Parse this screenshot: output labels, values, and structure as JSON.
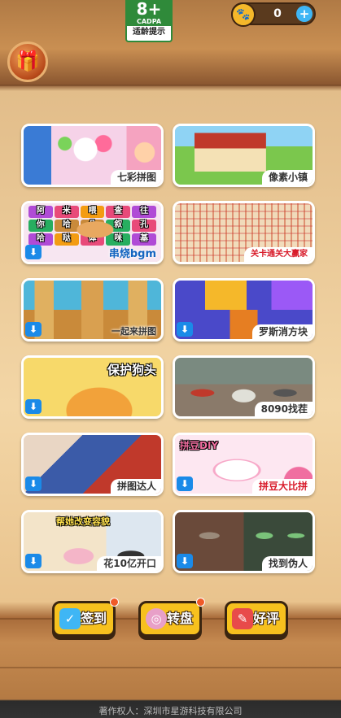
{
  "rating": {
    "age": "8+",
    "org": "CADPA",
    "hint": "适龄提示"
  },
  "coins": {
    "value": "0",
    "paw_icon": "paw-icon",
    "add_icon": "plus-icon"
  },
  "chest_icon": "treasure-chest-icon",
  "games": [
    {
      "label": "七彩拼图",
      "style": "plain"
    },
    {
      "label": "像素小镇",
      "style": "plain"
    },
    {
      "label": "串烧bgm",
      "style": "blue",
      "download": true
    },
    {
      "label": "关卡通关大赢家",
      "style": "red"
    },
    {
      "label": "一起来拼图",
      "style": "plain",
      "download": true
    },
    {
      "label": "罗斯消方块",
      "style": "plain",
      "download": true
    },
    {
      "label": "",
      "style": "none",
      "download": true,
      "banner": "保护狗头"
    },
    {
      "label": "8090找茬",
      "style": "plain"
    },
    {
      "label": "拼图达人",
      "style": "plain",
      "download": true
    },
    {
      "label": "拼豆大比拼",
      "style": "red",
      "download": true,
      "banner": "拼豆DIY"
    },
    {
      "label": "花10亿开口",
      "style": "plain",
      "download": true,
      "banner": "帮她改变容貌"
    },
    {
      "label": "找到伪人",
      "style": "plain",
      "download": true
    }
  ],
  "word_grid": [
    "阿",
    "米",
    "喂",
    "查",
    "往",
    "你",
    "哈",
    "朵",
    "叙",
    "孔",
    "哈",
    "哒",
    "体",
    "咪",
    "基"
  ],
  "buttons": {
    "checkin": "签到",
    "wheel": "转盘",
    "review": "好评"
  },
  "footer": "著作权人：深圳市星游科技有限公司"
}
